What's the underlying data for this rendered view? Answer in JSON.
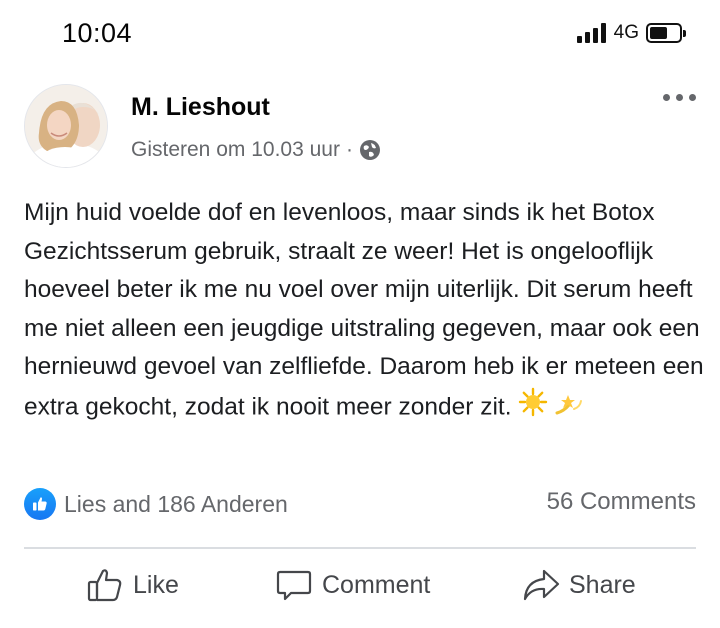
{
  "status_bar": {
    "time": "10:04",
    "network": "4G",
    "icons": [
      "signal-icon",
      "battery-icon"
    ]
  },
  "post": {
    "author": "M. Lieshout",
    "timestamp": "Gisteren om 10.03 uur",
    "separator": "·",
    "privacy_icon": "globe-icon",
    "text": "Mijn huid voelde dof en levenloos, maar sinds ik het Botox Gezichtsserum gebruik, straalt ze weer! Het is ongelooflijk hoeveel beter ik me nu voel over mijn uiterlijk. Dit serum heeft me niet alleen een jeugdige uitstraling gegeven, maar ook een hernieuwd gevoel van zelfliefde. Daarom heb ik er meteen een extra gekocht, zodat ik nooit meer zonder zit.",
    "emojis": [
      "sun-emoji",
      "dizzy-emoji"
    ],
    "reactions_text": "Lies and 186 Anderen",
    "comments_text": "56 Comments"
  },
  "actions": {
    "like": "Like",
    "comment": "Comment",
    "share": "Share"
  },
  "colors": {
    "accent": "#1877f2",
    "secondary_text": "#65676b",
    "divider": "#dadde1"
  }
}
